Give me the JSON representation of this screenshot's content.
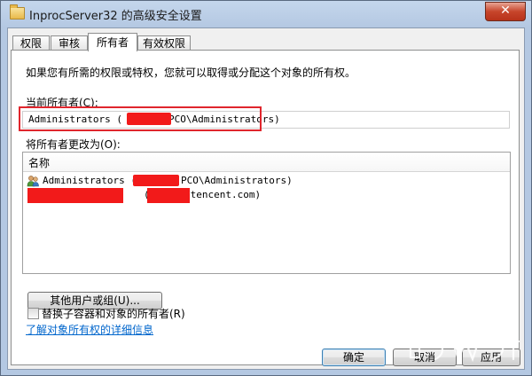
{
  "window": {
    "title": "InprocServer32 的高级安全设置",
    "close_label": "✕"
  },
  "tabs": [
    {
      "label": "权限"
    },
    {
      "label": "审核"
    },
    {
      "label": "所有者"
    },
    {
      "label": "有效权限"
    }
  ],
  "owner_tab": {
    "description": "如果您有所需的权限或特权，您就可以取得或分配这个对象的所有权。",
    "current_owner_label": "当前所有者(C):",
    "current_owner_value_prefix": "Administrators (",
    "current_owner_value_suffix": "PCO\\Administrators)",
    "change_to_label": "将所有者更改为(O):",
    "list_header": "名称",
    "list_items": [
      {
        "text_prefix": "Administrators (",
        "text_suffix": "PCO\\Administrators)",
        "icon": "group-icon"
      },
      {
        "text_prefix": "(",
        "text_suffix": "tencent.com)",
        "icon": "user-icon"
      }
    ],
    "other_users_button": "其他用户或组(U)...",
    "replace_checkbox_label": "替换子容器和对象的所有者(R)",
    "replace_checked": false,
    "details_link": "了解对象所有权的详细信息"
  },
  "footer": {
    "ok": "确定",
    "cancel_partial": "取消",
    "apply_partial": "应用"
  },
  "colors": {
    "highlight": "#e0262d",
    "redaction": "#f21a1a",
    "link": "#0066cc"
  }
}
